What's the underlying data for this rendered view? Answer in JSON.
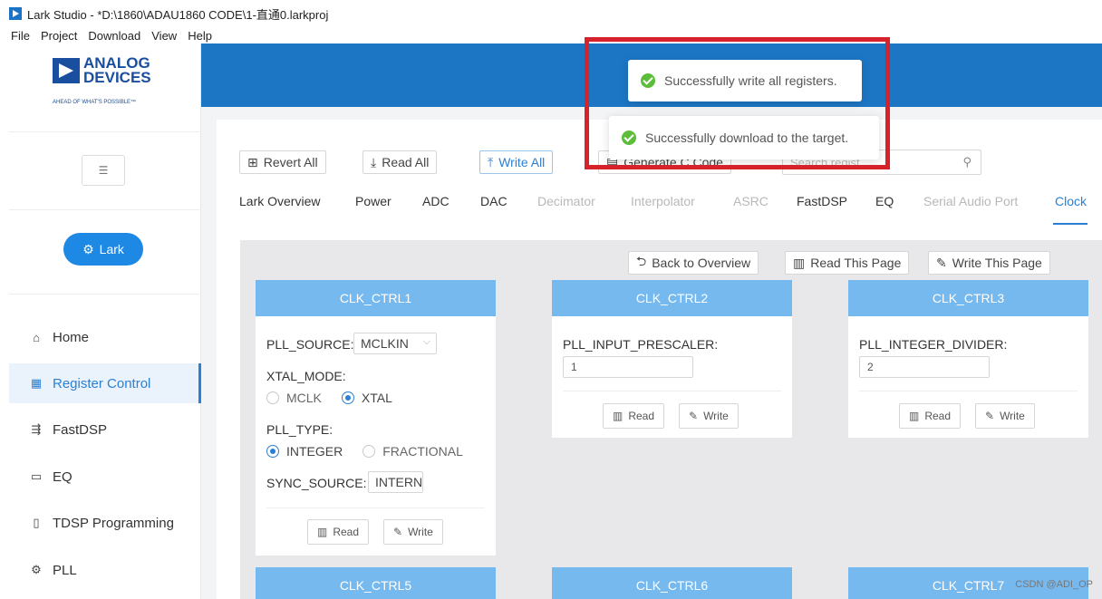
{
  "window": {
    "title": "Lark Studio - *D:\\1860\\ADAU1860 CODE\\1-直通0.larkproj"
  },
  "menu": [
    "File",
    "Project",
    "Download",
    "View",
    "Help"
  ],
  "logo": {
    "line1": "ANALOG",
    "line2": "DEVICES",
    "tagline": "AHEAD OF WHAT'S POSSIBLE™"
  },
  "sidebar": {
    "collapse_icon": "menu-fold-icon",
    "lark_button": "Lark",
    "items": [
      {
        "label": "Home",
        "icon": "home-icon"
      },
      {
        "label": "Register Control",
        "icon": "register-icon",
        "active": true
      },
      {
        "label": "FastDSP",
        "icon": "fastdsp-icon"
      },
      {
        "label": "EQ",
        "icon": "eq-icon"
      },
      {
        "label": "TDSP Programming",
        "icon": "chip-icon"
      },
      {
        "label": "PLL",
        "icon": "gear-icon"
      }
    ]
  },
  "toolbar": {
    "revert_all": "Revert All",
    "read_all": "Read All",
    "write_all": "Write All",
    "generate": "Generate C Code",
    "search_placeholder": "Search regist"
  },
  "tabs": [
    {
      "label": "Lark Overview",
      "state": "normal"
    },
    {
      "label": "Power",
      "state": "normal"
    },
    {
      "label": "ADC",
      "state": "normal"
    },
    {
      "label": "DAC",
      "state": "normal"
    },
    {
      "label": "Decimator",
      "state": "dim"
    },
    {
      "label": "Interpolator",
      "state": "dim"
    },
    {
      "label": "ASRC",
      "state": "dim"
    },
    {
      "label": "FastDSP",
      "state": "normal"
    },
    {
      "label": "EQ",
      "state": "normal"
    },
    {
      "label": "Serial Audio Port",
      "state": "dim"
    },
    {
      "label": "Clock",
      "state": "active"
    }
  ],
  "page_actions": {
    "back": "Back to Overview",
    "read_page": "Read This Page",
    "write_page": "Write This Page"
  },
  "cards": {
    "clk_ctrl1": {
      "title": "CLK_CTRL1",
      "pll_source_label": "PLL_SOURCE:",
      "pll_source_value": "MCLKIN",
      "xtal_mode_label": "XTAL_MODE:",
      "xtal_opt1": "MCLK",
      "xtal_opt2": "XTAL",
      "pll_type_label": "PLL_TYPE:",
      "pll_opt1": "INTEGER",
      "pll_opt2": "FRACTIONAL",
      "sync_label": "SYNC_SOURCE:",
      "sync_value": "INTERN",
      "read": "Read",
      "write": "Write"
    },
    "clk_ctrl2": {
      "title": "CLK_CTRL2",
      "label": "PLL_INPUT_PRESCALER:",
      "value": "1",
      "read": "Read",
      "write": "Write"
    },
    "clk_ctrl3": {
      "title": "CLK_CTRL3",
      "label": "PLL_INTEGER_DIVIDER:",
      "value": "2",
      "read": "Read",
      "write": "Write"
    },
    "clk_ctrl5": {
      "title": "CLK_CTRL5"
    },
    "clk_ctrl6": {
      "title": "CLK_CTRL6"
    },
    "clk_ctrl7": {
      "title": "CLK_CTRL7"
    }
  },
  "toasts": {
    "first": "Successfully write all registers.",
    "second": "Successfully download to the target."
  },
  "colors": {
    "accent": "#1c76c4",
    "card_header": "#76b9ef",
    "highlight": "#d6232b",
    "success": "#5cbd3a"
  },
  "watermark": "CSDN @ADI_OP"
}
